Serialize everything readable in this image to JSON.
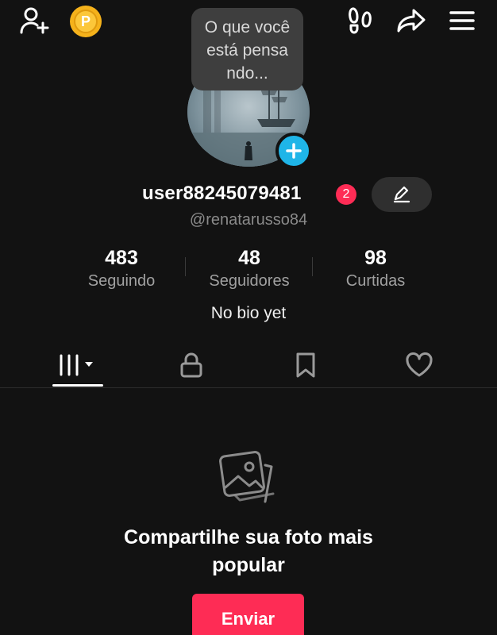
{
  "topbar": {
    "coin_letter": "P"
  },
  "bubble": {
    "lines": [
      "O que você",
      "está pensa",
      "ndo..."
    ]
  },
  "profile": {
    "username": "user88245079481",
    "notification_count": "2",
    "handle": "@renatarusso84",
    "bio": "No bio yet"
  },
  "stats": [
    {
      "value": "483",
      "label": "Seguindo"
    },
    {
      "value": "48",
      "label": "Seguidores"
    },
    {
      "value": "98",
      "label": "Curtidas"
    }
  ],
  "tabs": [
    {
      "icon": "grid-icon",
      "active": true
    },
    {
      "icon": "lock-icon",
      "active": false
    },
    {
      "icon": "bookmark-icon",
      "active": false
    },
    {
      "icon": "heart-icon",
      "active": false
    }
  ],
  "empty_state": {
    "title": "Compartilhe sua foto mais popular",
    "button_label": "Enviar"
  },
  "colors": {
    "background": "#121212",
    "accent": "#fe2c55",
    "add_badge": "#1fb5e8",
    "coin": "#f5b21b"
  }
}
